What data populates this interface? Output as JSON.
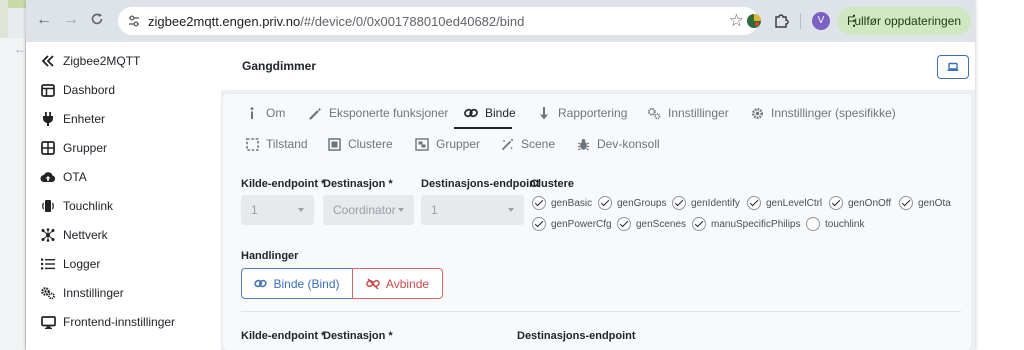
{
  "browser": {
    "url_host": "zigbee2mqtt.engen.priv.no",
    "url_path": "/#/device/0/0x001788010ed40682/bind",
    "profile_initial": "V",
    "update_label": "Fullfør oppdateringen"
  },
  "sidebar": {
    "brand": "Zigbee2MQTT",
    "items": [
      {
        "label": "Dashbord",
        "icon": "dashboard-icon"
      },
      {
        "label": "Enheter",
        "icon": "plug-icon"
      },
      {
        "label": "Grupper",
        "icon": "groups-icon"
      },
      {
        "label": "OTA",
        "icon": "cloud-upload-icon"
      },
      {
        "label": "Touchlink",
        "icon": "touchlink-icon"
      },
      {
        "label": "Nettverk",
        "icon": "network-icon"
      },
      {
        "label": "Logger",
        "icon": "list-icon"
      },
      {
        "label": "Innstillinger",
        "icon": "gears-icon"
      },
      {
        "label": "Frontend-innstillinger",
        "icon": "monitor-icon"
      }
    ]
  },
  "header": {
    "title": "Gangdimmer"
  },
  "tabs": {
    "row1": [
      "Om",
      "Eksponerte funksjoner",
      "Binde",
      "Rapportering",
      "Innstillinger",
      "Innstillinger (spesifikke)"
    ],
    "row2": [
      "Tilstand",
      "Clustere",
      "Grupper",
      "Scene",
      "Dev-konsoll"
    ],
    "active": "Binde"
  },
  "bind_rule": {
    "source_label": "Kilde-endpoint *",
    "dest_label": "Destinasjon *",
    "dest_ep_label": "Destinasjons-endpoint",
    "clusters_label": "Clustere",
    "source_value": "1",
    "dest_value": "Coordinator",
    "dest_ep_value": "1",
    "clusters": [
      {
        "name": "genBasic",
        "checked": true
      },
      {
        "name": "genGroups",
        "checked": true
      },
      {
        "name": "genIdentify",
        "checked": true
      },
      {
        "name": "genLevelCtrl",
        "checked": true
      },
      {
        "name": "genOnOff",
        "checked": true
      },
      {
        "name": "genOta",
        "checked": true
      },
      {
        "name": "genPowerCfg",
        "checked": true
      },
      {
        "name": "genScenes",
        "checked": true
      },
      {
        "name": "manuSpecificPhilips",
        "checked": true
      },
      {
        "name": "touchlink",
        "checked": false
      }
    ],
    "actions_label": "Handlinger",
    "bind_button": "Binde (Bind)",
    "unbind_button": "Avbinde"
  },
  "bind_rule_2": {
    "source_label": "Kilde-endpoint *",
    "dest_label": "Destinasjon *",
    "dest_ep_label": "Destinasjons-endpoint"
  }
}
